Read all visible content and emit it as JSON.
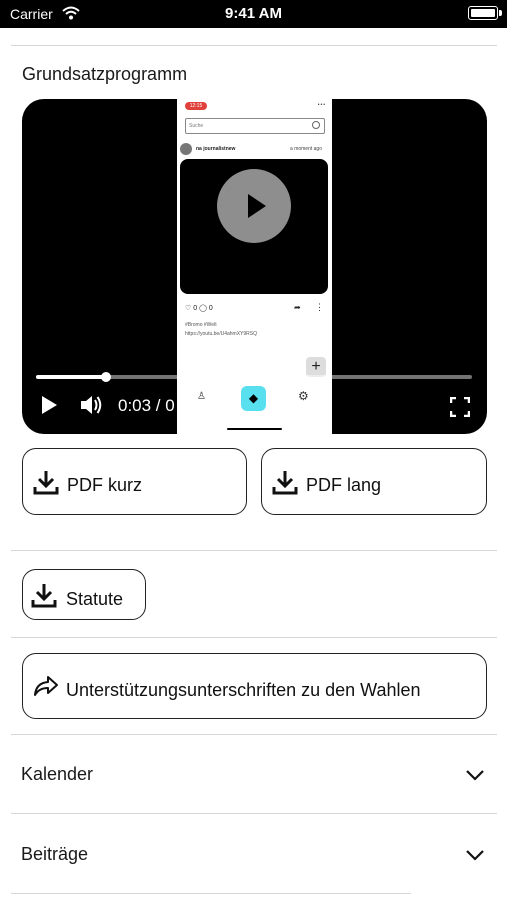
{
  "status_bar": {
    "carrier": "Carrier",
    "time": "9:41 AM"
  },
  "section": {
    "title": "Grundsatzprogramm"
  },
  "video": {
    "current_time": "0:03 / 0",
    "progress": 0.16,
    "embedded_app": {
      "status_pill": "12:15",
      "search_placeholder": "Suche",
      "username": "na journalistnew",
      "post_time": "a moment ago",
      "likes": "0",
      "comments": "0",
      "hashtags": "#Bromo #Welt",
      "link": "https://youtu.be/U4ahmXY9RSQ"
    }
  },
  "buttons": {
    "pdf_short": "PDF kurz",
    "pdf_long": "PDF lang",
    "statute": "Statute",
    "support_signatures": "Unterstützungsunterschriften zu den Wahlen"
  },
  "rows": {
    "calendar": "Kalender",
    "posts": "Beiträge"
  }
}
